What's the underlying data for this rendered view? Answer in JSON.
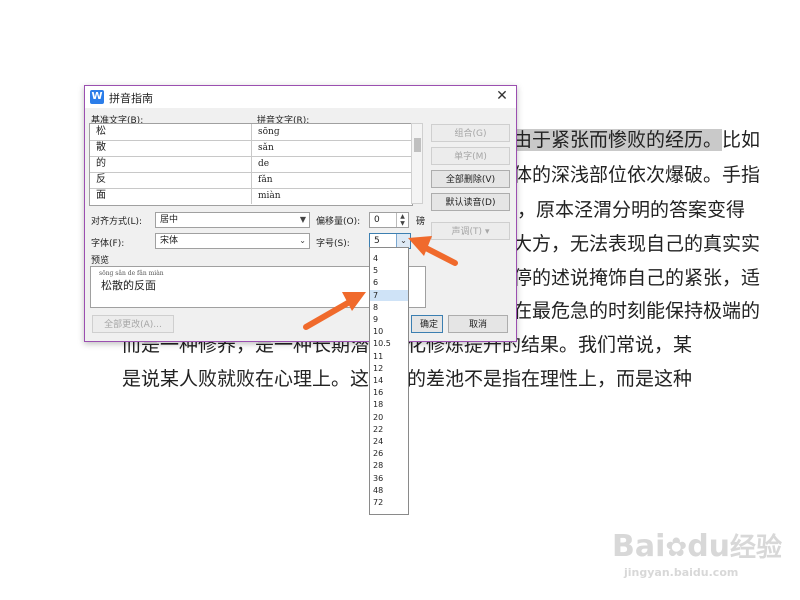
{
  "document": {
    "lines": [
      {
        "pre": "",
        "hl": "由于紧张而惨败的经历。",
        "post": "比如"
      },
      {
        "pre": "",
        "hl": "",
        "post": "体的深浅部位依次爆破。手指"
      },
      {
        "pre": "",
        "hl": "",
        "post": "，原本泾渭分明的答案变得"
      },
      {
        "pre": "",
        "hl": "",
        "post": "大方，无法表现自己的真实实"
      },
      {
        "pre": "",
        "hl": "",
        "post": "停的述说掩饰自己的紧张，适"
      },
      {
        "pre": "",
        "hl": "",
        "post": "在最危急的时刻能保持极端的"
      },
      {
        "pre": "",
        "hl": "",
        "post": "而是一种修养，是一种长期潜移默化修炼提升的结果。我们常说，某"
      },
      {
        "pre": "",
        "hl": "",
        "post": "是说某人败就败在心理上。这其中的差池不是指在理性上，而是这种"
      }
    ]
  },
  "dialog": {
    "title": "拼音指南",
    "app_icon": "W",
    "close_label": "✕",
    "base_text_label": "基准文字(B):",
    "pinyin_text_label": "拼音文字(R):",
    "rows": [
      {
        "base": "松",
        "pinyin": "sōnɡ"
      },
      {
        "base": "散",
        "pinyin": "sǎn"
      },
      {
        "base": "的",
        "pinyin": "de"
      },
      {
        "base": "反",
        "pinyin": "fǎn"
      },
      {
        "base": "面",
        "pinyin": "miàn"
      }
    ],
    "buttons": {
      "combine": "组合(G)",
      "single": "单字(M)",
      "clear_all": "全部删除(V)",
      "default_reading": "默认读音(D)",
      "tone": "声调(T)",
      "tone_arrow": "▾",
      "apply_all": "全部更改(A)...",
      "ok": "确定",
      "cancel": "取消"
    },
    "alignment_label": "对齐方式(L):",
    "alignment_value": "居中",
    "offset_label": "偏移量(O):",
    "offset_value": "0",
    "offset_unit": "磅",
    "font_label": "字体(F):",
    "font_value": "宋体",
    "size_label": "字号(S):",
    "size_value": "5",
    "size_unit": "磅",
    "preview_label": "预览",
    "preview_pinyin": "sōnɡ sǎn de fǎn miàn",
    "preview_text": "松散的反面",
    "size_options": [
      "4",
      "5",
      "6",
      "7",
      "8",
      "9",
      "10",
      "10.5",
      "11",
      "12",
      "14",
      "16",
      "18",
      "20",
      "22",
      "24",
      "26",
      "28",
      "36",
      "48",
      "72"
    ],
    "size_highlighted": "7"
  },
  "watermark": {
    "brand": "Bai",
    "brand_suffix": "du",
    "product": "经验",
    "url": "jingyan.baidu.com"
  },
  "colors": {
    "annotation_arrow": "#f06a2c",
    "dialog_border": "#9b4fb0",
    "selection": "#cfe3f7"
  }
}
